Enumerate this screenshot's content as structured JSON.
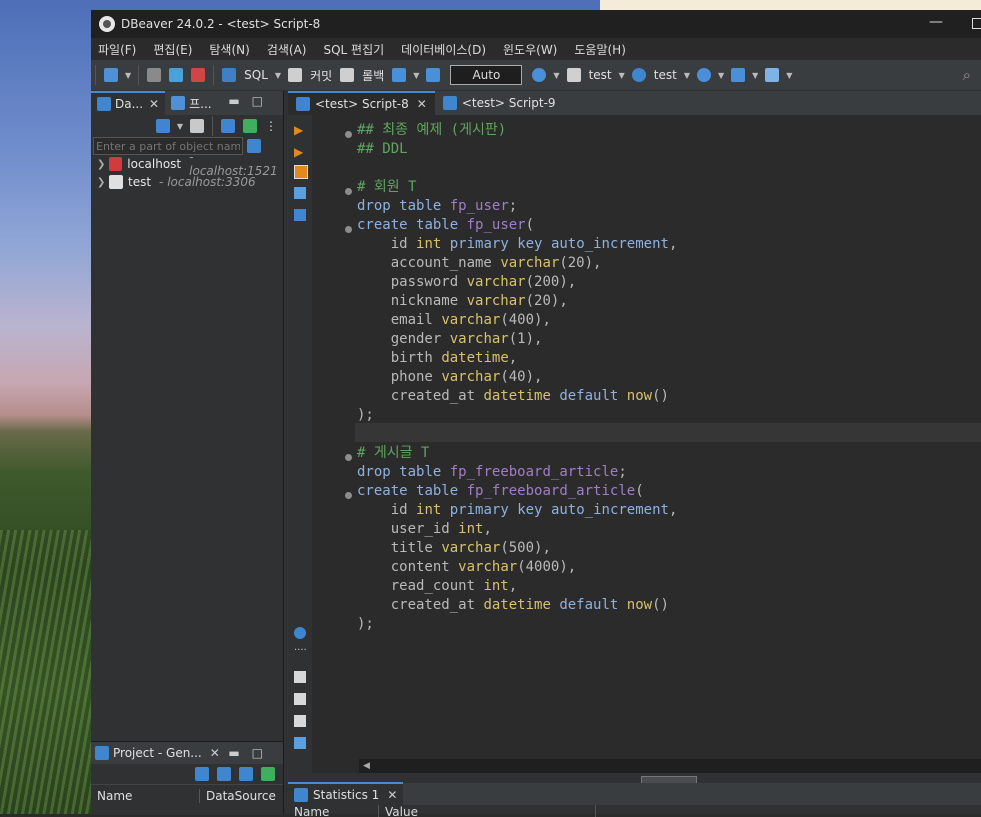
{
  "window": {
    "title": "DBeaver 24.0.2 - <test> Script-8",
    "minimize": "—"
  },
  "menu": [
    "파일(F)",
    "편집(E)",
    "탐색(N)",
    "검색(A)",
    "SQL 편집기",
    "데이터베이스(D)",
    "윈도우(W)",
    "도움말(H)"
  ],
  "toolbar": {
    "sql": "SQL",
    "commit": "커밋",
    "rollback": "롤백",
    "mode": "Auto",
    "datasource": "test",
    "schema": "test"
  },
  "navigator": {
    "tab1": "Da...",
    "tab2": "프...",
    "filter_placeholder": "Enter a part of object name",
    "connections": [
      {
        "name": "localhost",
        "host": "- localhost:1521"
      },
      {
        "name": "test",
        "host": "- localhost:3306"
      }
    ]
  },
  "project": {
    "tab": "Project - Gen...",
    "col_name": "Name",
    "col_ds": "DataSource"
  },
  "editor": {
    "tabs": [
      "<test> Script-8",
      "<test> Script-9"
    ]
  },
  "code": {
    "l1": "## 최종 예제 (게시판)",
    "l2": "## DDL",
    "l4": "# 회원 T",
    "l5a": "drop",
    "l5b": "table",
    "l5c": "fp_user",
    "l6a": "create",
    "l6b": "table",
    "l6c": "fp_user",
    "l7": [
      "id",
      "int",
      "primary",
      "key",
      "auto_increment"
    ],
    "l8": [
      "account_name",
      "varchar",
      "(20),"
    ],
    "l9": [
      "password",
      "varchar",
      "(200),"
    ],
    "l10": [
      "nickname",
      "varchar",
      "(20),"
    ],
    "l11": [
      "email",
      "varchar",
      "(400),"
    ],
    "l12": [
      "gender",
      "varchar",
      "(1),"
    ],
    "l13": [
      "birth",
      "datetime",
      ","
    ],
    "l14": [
      "phone",
      "varchar",
      "(40),"
    ],
    "l15": [
      "created_at",
      "datetime",
      "default",
      "now",
      "()"
    ],
    "l16": ");",
    "l18": "# 게시글 T",
    "l19c": "fp_freeboard_article",
    "l21": [
      "user_id",
      "int",
      ","
    ],
    "l22": [
      "title",
      "varchar",
      "(500),"
    ],
    "l23": [
      "content",
      "varchar",
      "(4000),"
    ],
    "l24": [
      "read_count",
      "int",
      ","
    ]
  },
  "results": {
    "tab": "Statistics 1",
    "col_name": "Name",
    "col_value": "Value"
  }
}
